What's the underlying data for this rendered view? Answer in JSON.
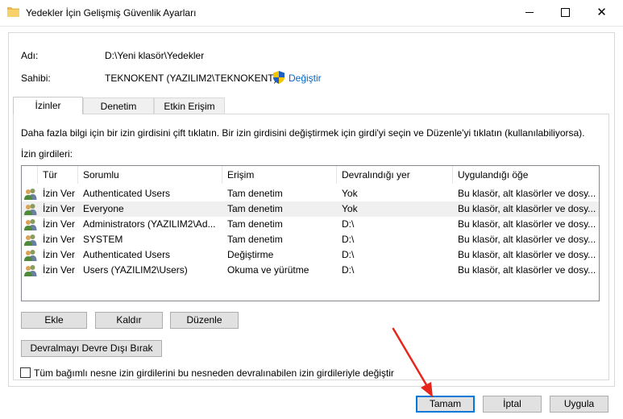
{
  "window": {
    "title": "Yedekler İçin Gelişmiş Güvenlik Ayarları"
  },
  "info": {
    "name_label": "Adı:",
    "name_value": "D:\\Yeni klasör\\Yedekler",
    "owner_label": "Sahibi:",
    "owner_value": "TEKNOKENT (YAZILIM2\\TEKNOKENT)",
    "change_link": "Değiştir"
  },
  "tabs": [
    {
      "label": "İzinler",
      "active": true
    },
    {
      "label": "Denetim",
      "active": false
    },
    {
      "label": "Etkin Erişim",
      "active": false
    }
  ],
  "permissions": {
    "hint": "Daha fazla bilgi için bir izin girdisini çift tıklatın. Bir izin girdisini değiştirmek için girdi'yi seçin ve Düzenle'yi tıklatın (kullanılabiliyorsa).",
    "entries_label": "İzin girdileri:",
    "columns": [
      "Tür",
      "Sorumlu",
      "Erişim",
      "Devralındığı yer",
      "Uygulandığı öğe"
    ],
    "rows": [
      {
        "type": "İzin Ver",
        "principal": "Authenticated Users",
        "access": "Tam denetim",
        "inherited": "Yok",
        "applies": "Bu klasör, alt klasörler ve dosy..."
      },
      {
        "type": "İzin Ver",
        "principal": "Everyone",
        "access": "Tam denetim",
        "inherited": "Yok",
        "applies": "Bu klasör, alt klasörler ve dosy..."
      },
      {
        "type": "İzin Ver",
        "principal": "Administrators (YAZILIM2\\Ad...",
        "access": "Tam denetim",
        "inherited": "D:\\",
        "applies": "Bu klasör, alt klasörler ve dosy..."
      },
      {
        "type": "İzin Ver",
        "principal": "SYSTEM",
        "access": "Tam denetim",
        "inherited": "D:\\",
        "applies": "Bu klasör, alt klasörler ve dosy..."
      },
      {
        "type": "İzin Ver",
        "principal": "Authenticated Users",
        "access": "Değiştirme",
        "inherited": "D:\\",
        "applies": "Bu klasör, alt klasörler ve dosy..."
      },
      {
        "type": "İzin Ver",
        "principal": "Users (YAZILIM2\\Users)",
        "access": "Okuma ve yürütme",
        "inherited": "D:\\",
        "applies": "Bu klasör, alt klasörler ve dosy..."
      }
    ],
    "selected_row": 1
  },
  "actions": {
    "add": "Ekle",
    "remove": "Kaldır",
    "edit": "Düzenle",
    "disable_inheritance": "Devralmayı Devre Dışı Bırak",
    "replace_checkbox": "Tüm bağımlı nesne izin girdilerini bu nesneden devralınabilen izin girdileriyle değiştir"
  },
  "footer": {
    "ok": "Tamam",
    "cancel": "İptal",
    "apply": "Uygula"
  },
  "colors": {
    "accent": "#0078d7",
    "link": "#0066cc",
    "annotation_arrow": "#e8251b",
    "selected_row": "#f0f0f0"
  }
}
